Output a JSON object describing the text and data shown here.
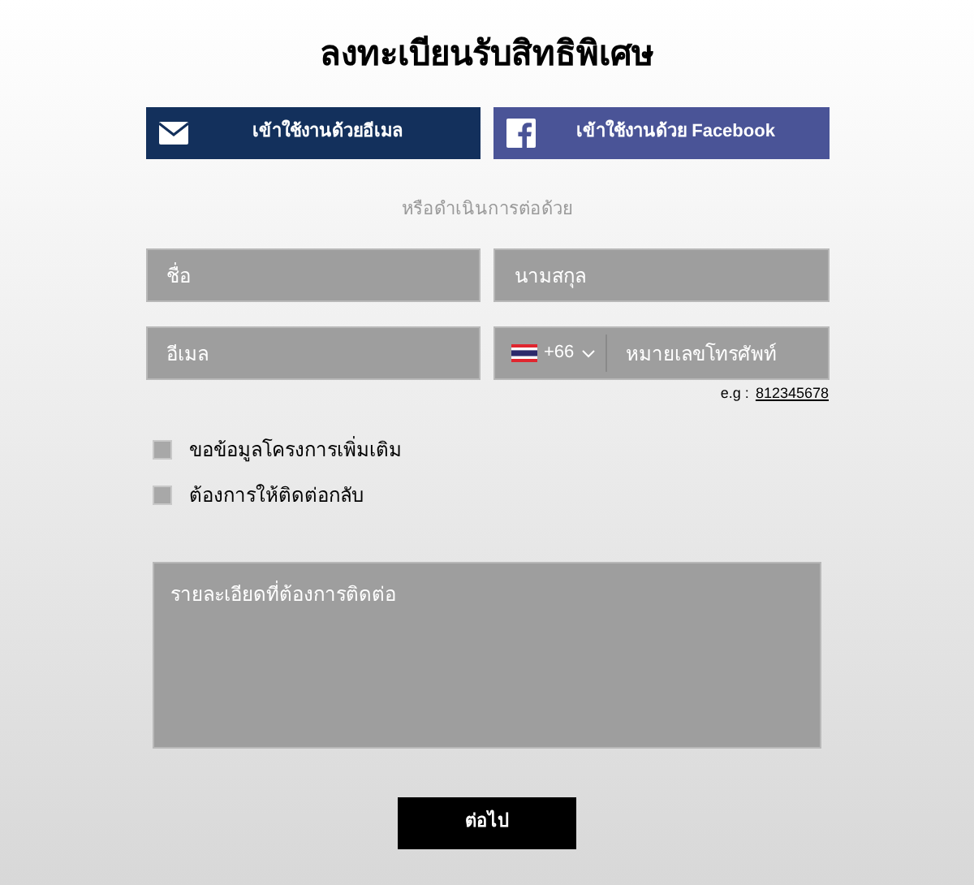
{
  "title": "ลงทะเบียนรับสิทธิพิเศษ",
  "login_buttons": [
    {
      "kind": "email",
      "label": "เข้าใช้งานด้วยอีเมล"
    },
    {
      "kind": "facebook",
      "label": "เข้าใช้งานด้วย Facebook"
    }
  ],
  "divider_text": "หรือดำเนินการต่อด้วย",
  "fields": [
    {
      "placeholder": "ชื่อ"
    },
    {
      "placeholder": "นามสกุล"
    },
    {
      "placeholder": "อีเมล"
    }
  ],
  "phone": {
    "country_code": "+66",
    "placeholder": "หมายเลขโทรศัพท์",
    "hint_prefix": "e.g :",
    "hint_example": "812345678"
  },
  "checkboxes": [
    {
      "label": "ขอข้อมูลโครงการเพิ่มเติม",
      "checked": false
    },
    {
      "label": "ต้องการให้ติดต่อกลับ",
      "checked": false
    }
  ],
  "message": {
    "placeholder": "รายละเอียดที่ต้องการติดต่อ"
  },
  "submit": "ต่อไป"
}
